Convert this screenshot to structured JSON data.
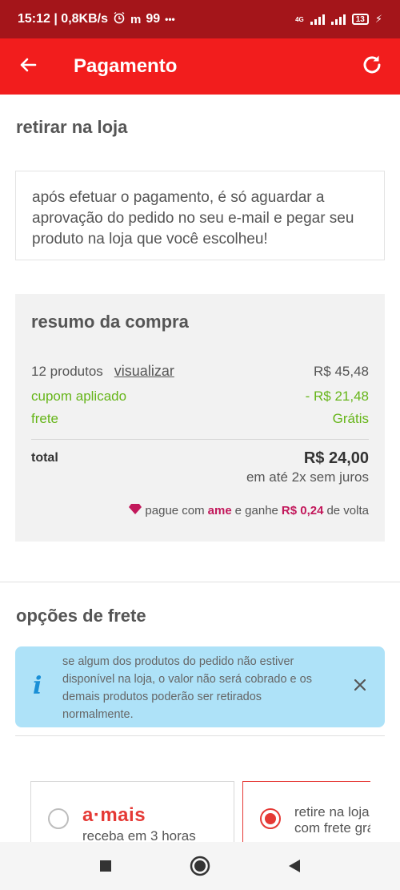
{
  "status_bar": {
    "time_speed": "15:12 | 0,8KB/s",
    "extra": "99",
    "dots": "•••",
    "network": "4G",
    "battery": "13"
  },
  "app_bar": {
    "title": "Pagamento",
    "back_icon": "arrow-left-icon",
    "refresh_icon": "refresh-icon"
  },
  "pickup": {
    "title": "retirar na loja",
    "description": "após efetuar o pagamento, é só aguardar a aprovação do pedido no seu e-mail e pegar seu produto na loja que você escolheu!"
  },
  "summary": {
    "title": "resumo da compra",
    "products_label": "12 produtos",
    "view_link": "visualizar",
    "products_value": "R$ 45,48",
    "coupon_label": "cupom aplicado",
    "coupon_value": "- R$ 21,48",
    "shipping_label": "frete",
    "shipping_value": "Grátis",
    "total_label": "total",
    "total_value": "R$ 24,00",
    "installments": "em até 2x sem juros",
    "ame_text_1": "pague com",
    "ame_brand": "ame",
    "ame_text_2": "e ganhe",
    "ame_cashback": "R$ 0,24",
    "ame_text_3": "de volta"
  },
  "shipping_options": {
    "title": "opções de frete",
    "notice": "se algum dos produtos do pedido não estiver disponível na loja, o valor não será cobrado e os demais produtos poderão ser retirados normalmente.",
    "option1_brand": "a·mais",
    "option1_sub": "receba em 3 horas",
    "option2_line1": "retire na loja",
    "option2_line2": "com frete grátis"
  },
  "colors": {
    "status_bar": "#a4151a",
    "app_bar": "#f21d1d",
    "accent_red": "#e53935",
    "green": "#66b519",
    "notice_bg": "#aee2f8",
    "ame_pink": "#c2185b"
  }
}
